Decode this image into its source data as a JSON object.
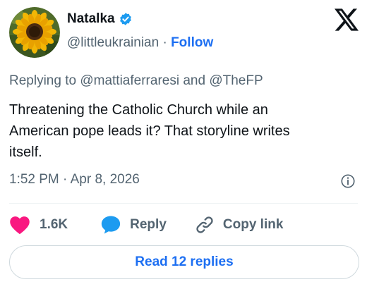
{
  "author": {
    "name": "Natalka",
    "handle": "@littleukrainian",
    "separator": "·",
    "follow_label": "Follow",
    "verified": true,
    "avatar_icon": "sunflower-avatar"
  },
  "reply_context": {
    "prefix": "Replying to",
    "mention_1": "@mattiaferraresi",
    "conjunction": "and",
    "mention_2": "@TheFP"
  },
  "tweet": {
    "text": "Threatening the Catholic Church while an\nAmerican pope leads it? That storyline writes\nitself.",
    "timestamp": "1:52 PM · Apr 8, 2026"
  },
  "actions": {
    "like_count": "1.6K",
    "reply_label": "Reply",
    "copy_link_label": "Copy link"
  },
  "read_replies_label": "Read 12 replies",
  "colors": {
    "accent": "#1d6ff2",
    "like": "#f91880",
    "reply": "#1d9bf0",
    "muted": "#536471"
  }
}
